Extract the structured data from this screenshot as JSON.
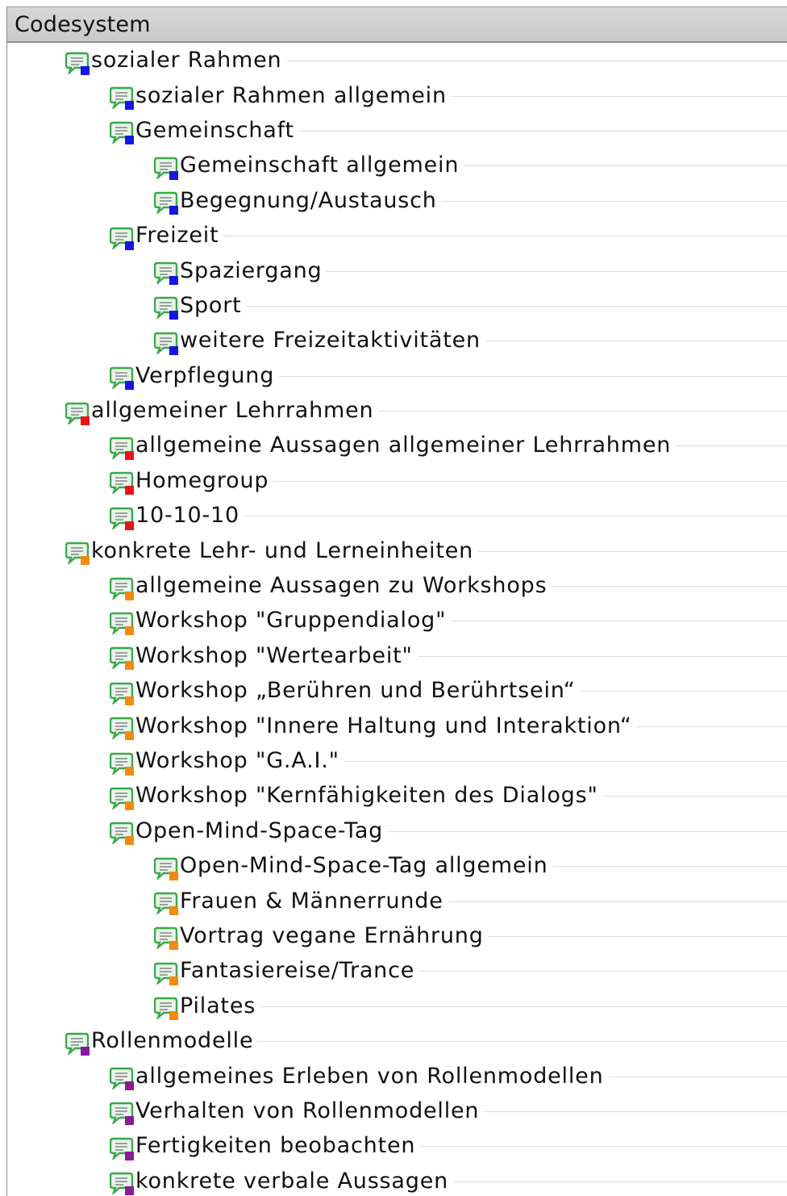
{
  "header": {
    "title": "Codesystem"
  },
  "colors": {
    "blue": "#1515e6",
    "red": "#e61515",
    "orange": "#f28a10",
    "purple": "#8b1a9a",
    "icon_green": "#3aa84a"
  },
  "tree": [
    {
      "label": "sozialer Rahmen",
      "level": 0,
      "color": "blue"
    },
    {
      "label": "sozialer Rahmen allgemein",
      "level": 1,
      "color": "blue"
    },
    {
      "label": "Gemeinschaft",
      "level": 1,
      "color": "blue"
    },
    {
      "label": "Gemeinschaft allgemein",
      "level": 2,
      "color": "blue"
    },
    {
      "label": "Begegnung/Austausch",
      "level": 2,
      "color": "blue"
    },
    {
      "label": "Freizeit",
      "level": 1,
      "color": "blue"
    },
    {
      "label": "Spaziergang",
      "level": 2,
      "color": "blue"
    },
    {
      "label": "Sport",
      "level": 2,
      "color": "blue"
    },
    {
      "label": "weitere Freizeitaktivitäten",
      "level": 2,
      "color": "blue"
    },
    {
      "label": "Verpflegung",
      "level": 1,
      "color": "blue"
    },
    {
      "label": "allgemeiner Lehrrahmen",
      "level": 0,
      "color": "red"
    },
    {
      "label": "allgemeine Aussagen allgemeiner Lehrrahmen",
      "level": 1,
      "color": "red"
    },
    {
      "label": "Homegroup",
      "level": 1,
      "color": "red"
    },
    {
      "label": "10-10-10",
      "level": 1,
      "color": "red"
    },
    {
      "label": "konkrete Lehr- und Lerneinheiten",
      "level": 0,
      "color": "orange"
    },
    {
      "label": "allgemeine Aussagen zu Workshops",
      "level": 1,
      "color": "orange"
    },
    {
      "label": "Workshop \"Gruppendialog\"",
      "level": 1,
      "color": "orange"
    },
    {
      "label": "Workshop \"Wertearbeit\"",
      "level": 1,
      "color": "orange"
    },
    {
      "label": "Workshop „Berühren und Berührtsein“",
      "level": 1,
      "color": "orange"
    },
    {
      "label": "Workshop \"Innere Haltung und Interaktion“",
      "level": 1,
      "color": "orange"
    },
    {
      "label": "Workshop \"G.A.I.\"",
      "level": 1,
      "color": "orange"
    },
    {
      "label": "Workshop \"Kernfähigkeiten des Dialogs\"",
      "level": 1,
      "color": "orange"
    },
    {
      "label": "Open-Mind-Space-Tag",
      "level": 1,
      "color": "orange"
    },
    {
      "label": "Open-Mind-Space-Tag allgemein",
      "level": 2,
      "color": "orange"
    },
    {
      "label": "Frauen & Männerrunde",
      "level": 2,
      "color": "orange"
    },
    {
      "label": "Vortrag vegane Ernährung",
      "level": 2,
      "color": "orange"
    },
    {
      "label": "Fantasiereise/Trance",
      "level": 2,
      "color": "orange"
    },
    {
      "label": "Pilates",
      "level": 2,
      "color": "orange"
    },
    {
      "label": "Rollenmodelle",
      "level": 0,
      "color": "purple"
    },
    {
      "label": "allgemeines Erleben von Rollenmodellen",
      "level": 1,
      "color": "purple"
    },
    {
      "label": "Verhalten von Rollenmodellen",
      "level": 1,
      "color": "purple"
    },
    {
      "label": "Fertigkeiten beobachten",
      "level": 1,
      "color": "purple"
    },
    {
      "label": "konkrete verbale Aussagen",
      "level": 1,
      "color": "purple"
    }
  ]
}
